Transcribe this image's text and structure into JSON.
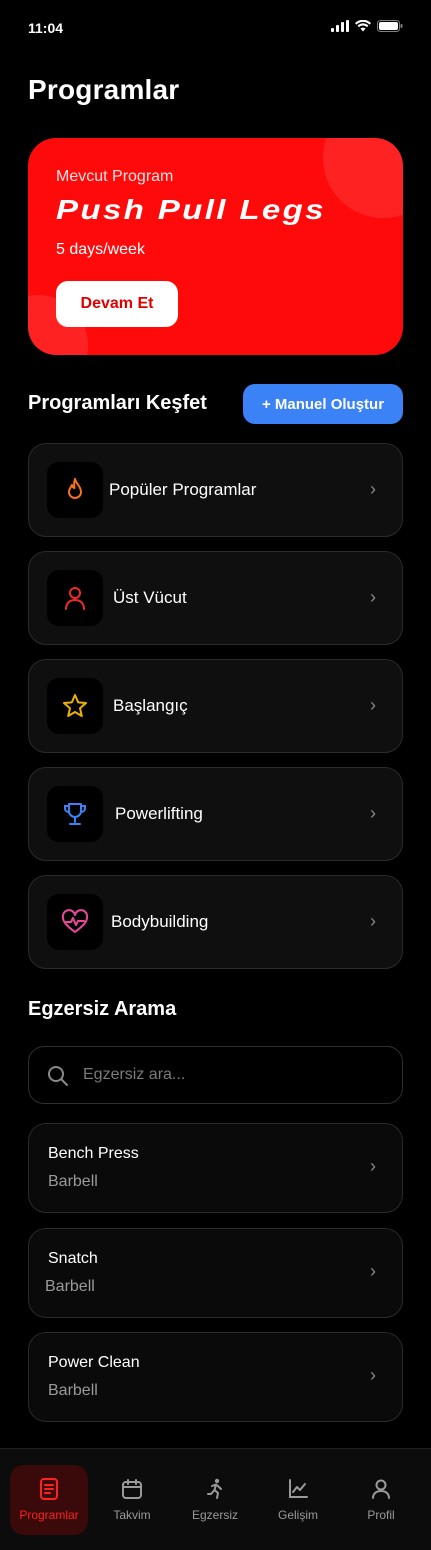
{
  "status_bar": {
    "time": "11:04"
  },
  "page": {
    "title": "Programlar"
  },
  "current_program": {
    "label": "Mevcut Program",
    "name": "Push Pull Legs",
    "frequency": "5 days/week",
    "continue_label": "Devam Et"
  },
  "explore": {
    "title": "Programları Keşfet",
    "manual_create_label": "+ Manuel Oluştur",
    "categories": [
      {
        "label": "Popüler Programlar",
        "icon": "flame-icon",
        "color": "#f97316"
      },
      {
        "label": "Üst Vücut",
        "icon": "person-icon",
        "color": "#ef2a2a"
      },
      {
        "label": "Başlangıç",
        "icon": "star-icon",
        "color": "#eab308"
      },
      {
        "label": "Powerlifting",
        "icon": "trophy-icon",
        "color": "#3b82f6"
      },
      {
        "label": "Bodybuilding",
        "icon": "heart-pulse-icon",
        "color": "#ec4899"
      }
    ]
  },
  "exercise_search": {
    "title": "Egzersiz Arama",
    "placeholder": "Egzersiz ara...",
    "results": [
      {
        "name": "Bench Press",
        "equipment": "Barbell"
      },
      {
        "name": "Snatch",
        "equipment": "Barbell"
      },
      {
        "name": "Power Clean",
        "equipment": "Barbell"
      }
    ]
  },
  "tab_bar": {
    "active": "Programlar",
    "tabs": [
      {
        "label": "Programlar",
        "icon": "document-icon"
      },
      {
        "label": "Takvim",
        "icon": "calendar-icon"
      },
      {
        "label": "Egzersiz",
        "icon": "running-icon"
      },
      {
        "label": "Gelişim",
        "icon": "chart-icon"
      },
      {
        "label": "Profil",
        "icon": "user-icon"
      }
    ]
  },
  "colors": {
    "accent_red": "#ff0a0a",
    "accent_blue": "#3b82f6",
    "background": "#000000",
    "card": "#0f0f0f"
  }
}
